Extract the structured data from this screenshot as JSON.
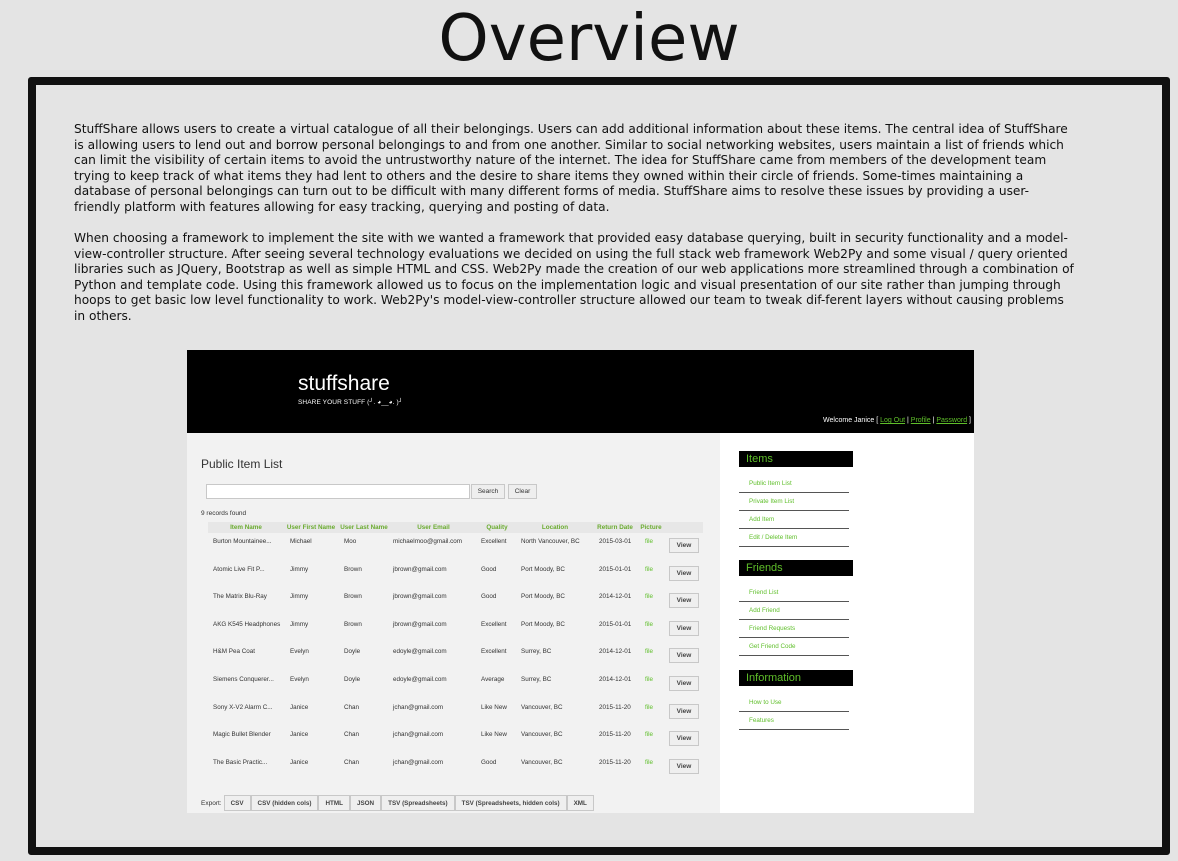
{
  "page": {
    "title": "Overview",
    "paragraphs": [
      "StuffShare allows users to create a virtual catalogue of all their belongings. Users can add additional information about these items. The central idea of StuffShare is allowing users to lend out and borrow personal belongings to and from one another. Similar to social networking websites, users maintain a list of friends which can limit the visibility of certain items to avoid the untrustworthy nature of the internet. The idea for StuffShare came from members of the development team trying to keep track of what items they had lent to others and the desire to share items they owned within their circle of friends. Some-times maintaining a database of personal belongings can turn out to be difficult with many different forms of media. StuffShare aims to resolve these issues by providing a user-friendly platform with features allowing for easy tracking, querying and posting of data.",
      "When choosing a framework to implement the site with we wanted a framework that provided easy database querying, built in security functionality and a model-view-controller structure. After seeing several technology evaluations we decided on using the full stack web framework Web2Py and some visual / query oriented libraries such as JQuery, Bootstrap as well as simple HTML and CSS. Web2Py made the creation of our web applications more streamlined through a combination of Python and template code. Using this framework allowed us to focus on the implementation logic and visual presentation of our site rather than jumping through hoops to get basic low level functionality to work. Web2Py's model-view-controller structure allowed our team to tweak dif-ferent layers without causing problems in others."
    ]
  },
  "app": {
    "brand": "stuffshare",
    "tagline": "SHARE YOUR STUFF (╯. ◕__◕. )╯",
    "welcome": {
      "prefix": "Welcome Janice [",
      "logout": "Log Out",
      "sep1": "|",
      "profile": "Profile",
      "sep2": "|",
      "password": "Password",
      "suffix": "]"
    },
    "list": {
      "title": "Public Item List",
      "search_value": "",
      "search_label": "Search",
      "clear_label": "Clear",
      "records": "9 records found",
      "columns": [
        "Item Name",
        "User First Name",
        "User Last Name",
        "User Email",
        "Quality",
        "Location",
        "Return Date",
        "Picture"
      ],
      "view_label": "View",
      "rows": [
        [
          "Burton Mountainee...",
          "Michael",
          "Moo",
          "michaelmoo@gmail.com",
          "Excellent",
          "North Vancouver, BC",
          "2015-03-01",
          "file"
        ],
        [
          "Atomic Live Fit P...",
          "Jimmy",
          "Brown",
          "jbrown@gmail.com",
          "Good",
          "Port Moody, BC",
          "2015-01-01",
          "file"
        ],
        [
          "The Matrix Blu-Ray",
          "Jimmy",
          "Brown",
          "jbrown@gmail.com",
          "Good",
          "Port Moody, BC",
          "2014-12-01",
          "file"
        ],
        [
          "AKG K545 Headphones",
          "Jimmy",
          "Brown",
          "jbrown@gmail.com",
          "Excellent",
          "Port Moody, BC",
          "2015-01-01",
          "file"
        ],
        [
          "H&M Pea Coat",
          "Evelyn",
          "Doyle",
          "edoyle@gmail.com",
          "Excellent",
          "Surrey, BC",
          "2014-12-01",
          "file"
        ],
        [
          "Siemens Conquerer...",
          "Evelyn",
          "Doyle",
          "edoyle@gmail.com",
          "Average",
          "Surrey, BC",
          "2014-12-01",
          "file"
        ],
        [
          "Sony X-V2 Alarm C...",
          "Janice",
          "Chan",
          "jchan@gmail.com",
          "Like New",
          "Vancouver, BC",
          "2015-11-20",
          "file"
        ],
        [
          "Magic Bullet Blender",
          "Janice",
          "Chan",
          "jchan@gmail.com",
          "Like New",
          "Vancouver, BC",
          "2015-11-20",
          "file"
        ],
        [
          "The Basic Practic...",
          "Janice",
          "Chan",
          "jchan@gmail.com",
          "Good",
          "Vancouver, BC",
          "2015-11-20",
          "file"
        ]
      ],
      "export_label": "Export:",
      "export_buttons": [
        "CSV",
        "CSV (hidden cols)",
        "HTML",
        "JSON",
        "TSV (Spreadsheets)",
        "TSV (Spreadsheets, hidden cols)",
        "XML"
      ]
    },
    "sidebar": {
      "sections": [
        {
          "title": "Items",
          "links": [
            "Public Item List",
            "Private Item List",
            "Add Item",
            "Edit / Delete Item"
          ]
        },
        {
          "title": "Friends",
          "links": [
            "Friend List",
            "Add Friend",
            "Friend Requests",
            "Get Friend Code"
          ]
        },
        {
          "title": "Information",
          "links": [
            "How to Use",
            "Features"
          ]
        }
      ]
    }
  }
}
